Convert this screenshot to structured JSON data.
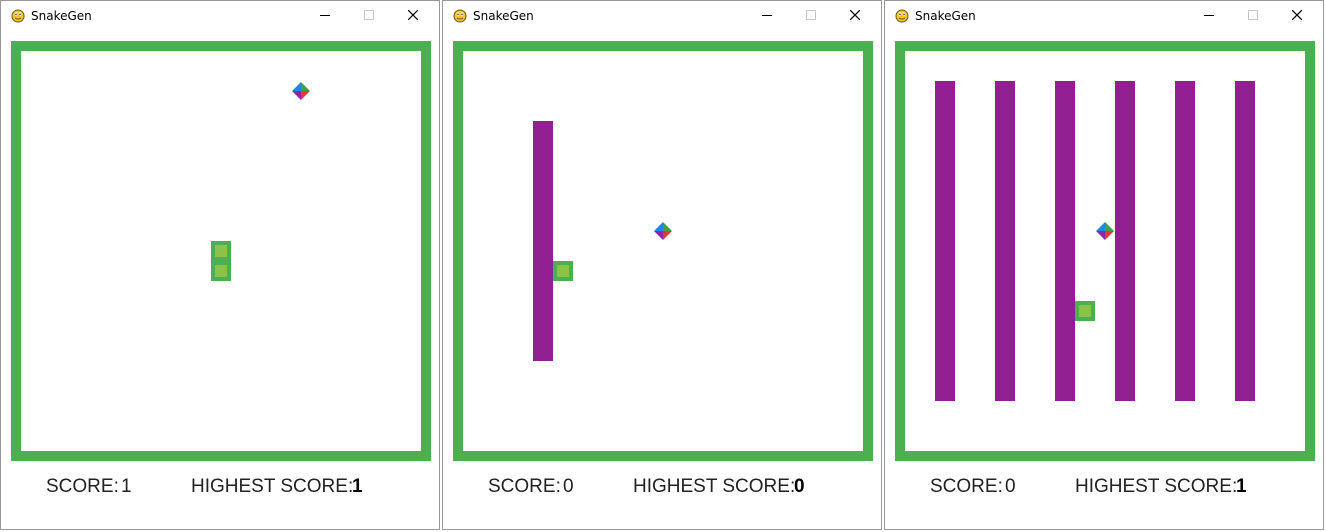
{
  "windows": [
    {
      "title": "SnakeGen",
      "score_label": "SCORE:",
      "score": "1",
      "highest_label": "HIGHEST SCORE:",
      "highest": "1",
      "snake_cells": [
        [
          10,
          10
        ],
        [
          10,
          11
        ]
      ],
      "food_cell": [
        14,
        2
      ],
      "obstacles": []
    },
    {
      "title": "SnakeGen",
      "score_label": "SCORE:",
      "score": "0",
      "highest_label": "HIGHEST SCORE:",
      "highest": "0",
      "snake_cells": [
        [
          5,
          11
        ]
      ],
      "food_cell": [
        10,
        9
      ],
      "obstacles": [
        {
          "col": 4,
          "row_start": 4,
          "row_end": 15
        }
      ]
    },
    {
      "title": "SnakeGen",
      "score_label": "SCORE:",
      "score": "0",
      "highest_label": "HIGHEST SCORE:",
      "highest": "1",
      "snake_cells": [
        [
          9,
          13
        ]
      ],
      "food_cell": [
        10,
        9
      ],
      "obstacles": [
        {
          "col": 2,
          "row_start": 2,
          "row_end": 17
        },
        {
          "col": 5,
          "row_start": 2,
          "row_end": 17
        },
        {
          "col": 8,
          "row_start": 2,
          "row_end": 17
        },
        {
          "col": 11,
          "row_start": 2,
          "row_end": 17
        },
        {
          "col": 14,
          "row_start": 2,
          "row_end": 17
        },
        {
          "col": 17,
          "row_start": 2,
          "row_end": 17
        }
      ]
    }
  ],
  "colors": {
    "wall": "#4caf50",
    "snake_body": "#4caf50",
    "snake_inner": "#8bc34a",
    "obstacle": "#921f92",
    "food_colors": [
      "#e53935",
      "#43a047",
      "#1e88e5",
      "#8e24aa"
    ]
  },
  "icons": {
    "app": "pygame-snake-icon",
    "minimize": "minimize-icon",
    "maximize": "maximize-icon",
    "close": "close-icon"
  }
}
